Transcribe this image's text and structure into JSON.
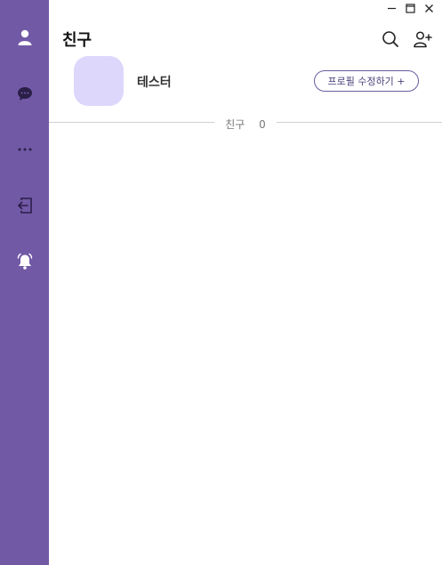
{
  "sidebar": {
    "items": [
      {
        "icon": "person-icon"
      },
      {
        "icon": "chat-icon"
      },
      {
        "icon": "more-icon"
      },
      {
        "icon": "logout-icon"
      },
      {
        "icon": "bell-icon"
      }
    ],
    "background": "#7159a6"
  },
  "window": {
    "controls": [
      "minimize-icon",
      "maximize-icon",
      "close-icon"
    ]
  },
  "header": {
    "title": "친구",
    "icons": [
      "search-icon",
      "add-friend-icon"
    ]
  },
  "profile": {
    "name": "테스터",
    "edit_label": "프로필 수정하기 +",
    "avatar_color": "#ddd7fc"
  },
  "friends": {
    "label": "친구",
    "count": "0"
  }
}
